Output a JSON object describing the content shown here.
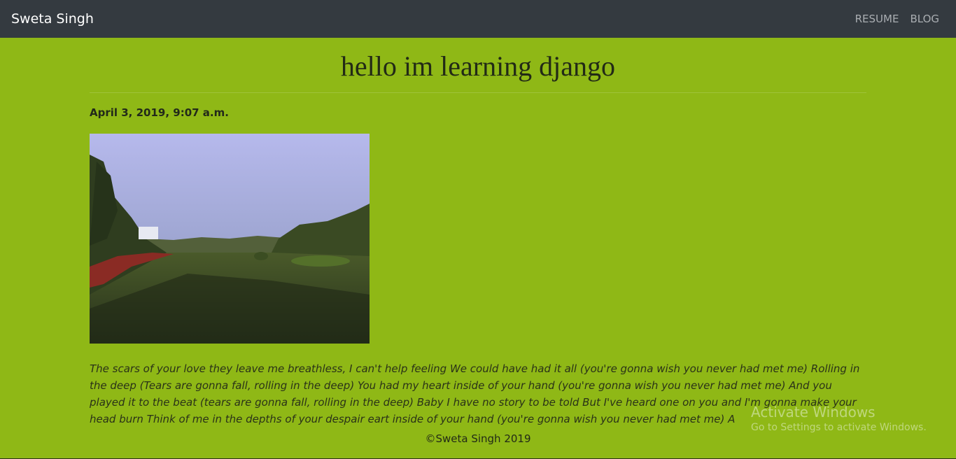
{
  "nav": {
    "brand": "Sweta Singh",
    "links": [
      "RESUME",
      "BLOG"
    ]
  },
  "post": {
    "title": "hello im learning django",
    "date": "April 3, 2019, 9:07 a.m.",
    "body": "The scars of your love they leave me breathless, I can't help feeling We could have had it all (you're gonna wish you never had met me) Rolling in the deep (Tears are gonna fall, rolling in the deep) You had my heart inside of your hand (you're gonna wish you never had met me) And you played it to the beat (tears are gonna fall, rolling in the deep) Baby I have no story to be told But I've heard one on you and I'm gonna make your head burn Think of me in the depths of your despair eart inside of your hand (you're gonna wish you never had met me) A"
  },
  "footer": {
    "text": "©Sweta Singh 2019"
  },
  "watermark": {
    "title": "Activate Windows",
    "subtitle": "Go to Settings to activate Windows."
  },
  "colors": {
    "page_bg": "#8fb816",
    "navbar_bg": "#343a40",
    "brand_text": "#ffffff",
    "nav_link_text": "#a9adb1"
  }
}
